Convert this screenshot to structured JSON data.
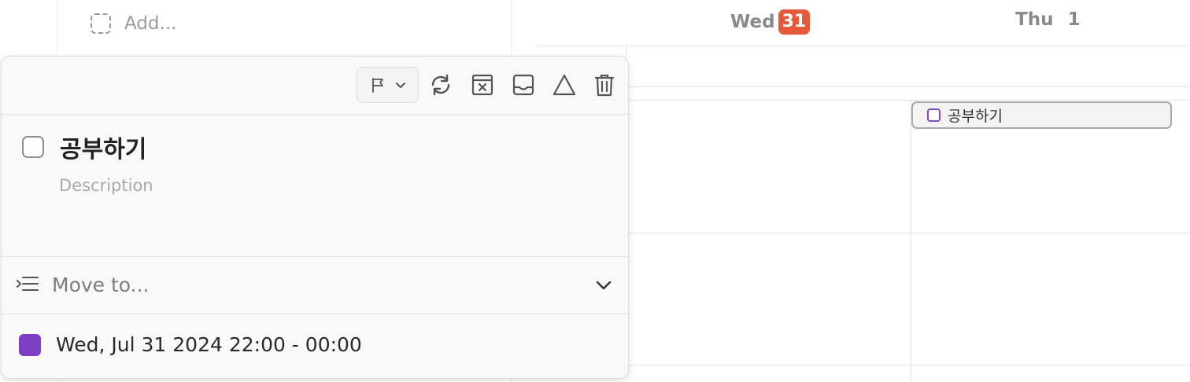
{
  "list": {
    "add_label": "Add..."
  },
  "calendar": {
    "days": [
      {
        "name": "Wed",
        "number": "31",
        "is_today": true
      },
      {
        "name": "Thu",
        "number": "1",
        "is_today": false
      }
    ],
    "today_badge_color": "#e45a3b",
    "events": [
      {
        "title": "공부하기",
        "day": "Thu",
        "color": "#8446c7"
      }
    ]
  },
  "task_popover": {
    "toolbar": {
      "icons": [
        "flag-icon",
        "chevron-down-icon",
        "repeat-icon",
        "remove-from-calendar-icon",
        "inbox-icon",
        "someday-triangle-icon",
        "trash-icon"
      ]
    },
    "title": "공부하기",
    "description_placeholder": "Description",
    "move_to_label": "Move to...",
    "date_range": "Wed, Jul 31 2024 22:00 - 00:00",
    "event_color": "#7f3fc4"
  }
}
